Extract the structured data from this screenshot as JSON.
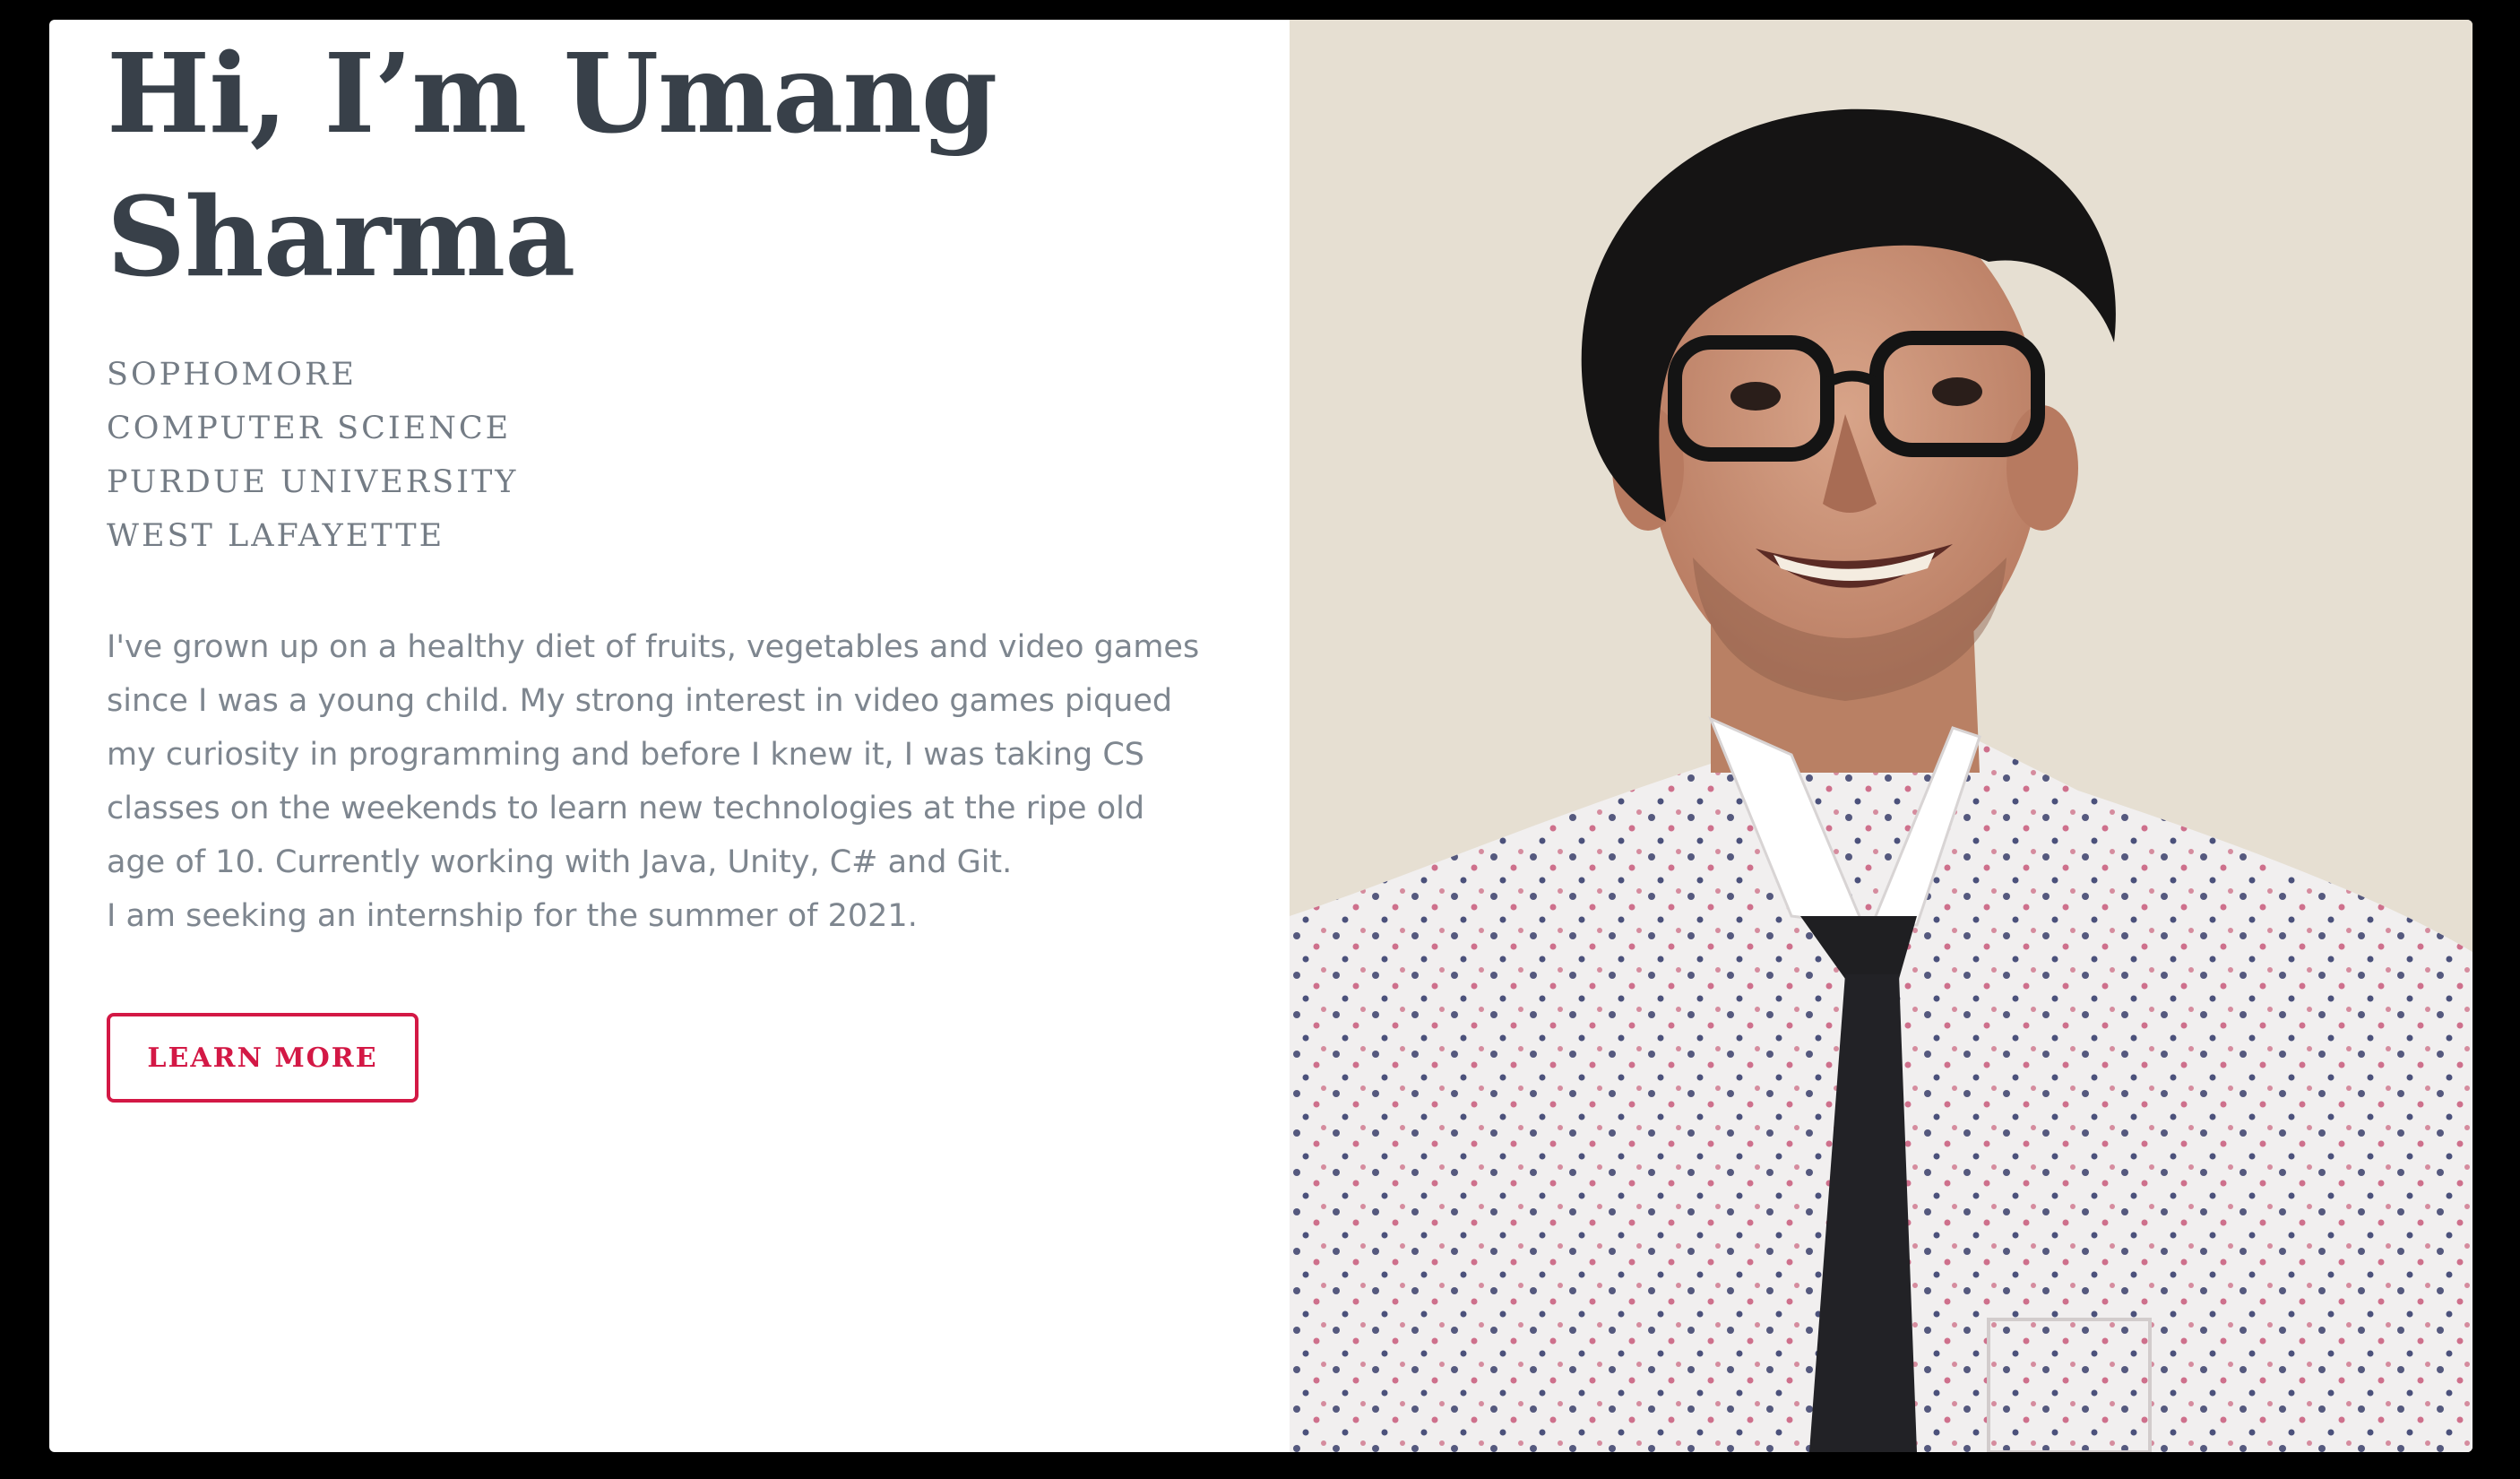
{
  "hero": {
    "title": "Hi, I’m Umang Sharma",
    "meta": [
      "SOPHOMORE",
      "COMPUTER SCIENCE",
      "PURDUE UNIVERSITY",
      "WEST LAFAYETTE"
    ],
    "bio_lines": [
      "I've grown up on a healthy diet of fruits, vegetables and video games",
      "since I was a young child. My strong interest in video games piqued",
      "my curiosity in programming and before I knew it, I was taking CS",
      "classes on the weekends to learn new technologies at the ripe old",
      "age of 10. Currently working with Java, Unity, C# and Git.",
      "I am seeking an internship for the summer of 2021."
    ],
    "cta_label": "LEARN MORE"
  },
  "colors": {
    "heading": "#384049",
    "meta_text": "#747c85",
    "body_text": "#7e868f",
    "accent": "#d31845",
    "background": "#ffffff",
    "frame": "#000000"
  },
  "photo": {
    "icon": "portrait-photo"
  }
}
